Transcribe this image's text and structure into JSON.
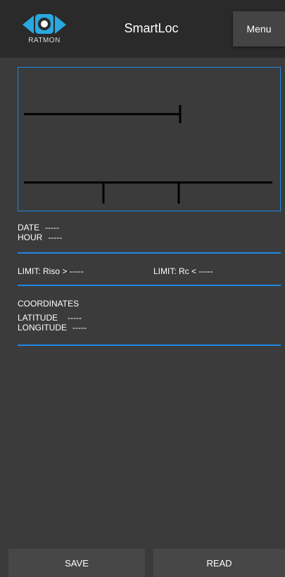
{
  "header": {
    "logo_text": "RATMON",
    "title": "SmartLoc",
    "menu_label": "Menu"
  },
  "colors": {
    "accent": "#1e88e5",
    "background": "#3b3b3b",
    "header": "#2a2a2a"
  },
  "icons": {
    "logo": "ratmon-eye-logo"
  },
  "measurement": {
    "date_label": "DATE",
    "date_value": "-----",
    "hour_label": "HOUR",
    "hour_value": "-----"
  },
  "limits": {
    "riso_label": "LIMIT: Riso >",
    "riso_value": "-----",
    "rc_label": "LIMIT: Rc <",
    "rc_value": "-----"
  },
  "coordinates": {
    "title": "COORDINATES",
    "latitude_label": "LATITUDE",
    "latitude_value": "-----",
    "longitude_label": "LONGITUDE",
    "longitude_value": "-----"
  },
  "actions": {
    "save_label": "SAVE",
    "read_label": "READ"
  }
}
